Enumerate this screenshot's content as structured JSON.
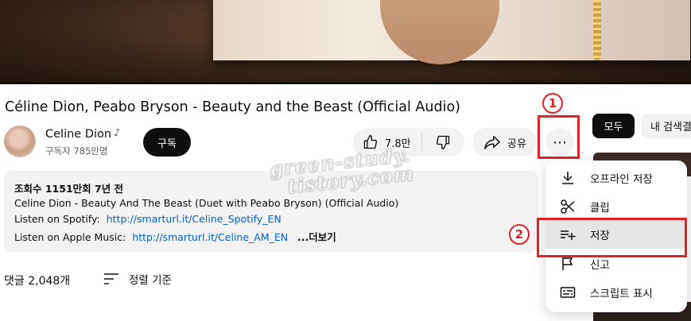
{
  "video": {
    "title": "Céline Dion, Peabo Bryson - Beauty and the Beast (Official Audio)"
  },
  "channel": {
    "name": "Celine Dion",
    "music_icon": "♪",
    "subscribers": "구독자 785만명",
    "subscribe_label": "구독"
  },
  "actions": {
    "like_count": "7.8만",
    "share_label": "공유",
    "more_label": "⋯",
    "like_icon": "thumbs-up-icon",
    "dislike_icon": "thumbs-down-icon",
    "share_icon": "share-arrow-icon"
  },
  "annotations": {
    "badge1": "1",
    "badge2": "2",
    "highlight_color": "#e0222a"
  },
  "description": {
    "stats": "조회수 1151만회  7년 전",
    "line1": "Celine Dion - Beauty And The Beast (Duet with Peabo Bryson) (Official Audio)",
    "spotify_prefix": "Listen on Spotify:",
    "spotify_link": "http://smarturl.it/Celine_Spotify_EN",
    "apple_prefix": "Listen on Apple Music:",
    "apple_link": "http://smarturl.it/Celine_AM_EN",
    "more_label": "...더보기"
  },
  "comments": {
    "count_label": "댓글 2,048개",
    "sort_label": "정렬 기준"
  },
  "chips": {
    "all": "모두",
    "search": "내 검색결"
  },
  "menu": {
    "items": [
      {
        "label": "오프라인 저장",
        "icon": "download-icon"
      },
      {
        "label": "클립",
        "icon": "scissors-icon"
      },
      {
        "label": "저장",
        "icon": "playlist-add-icon",
        "highlighted": true
      },
      {
        "label": "신고",
        "icon": "flag-icon"
      },
      {
        "label": "스크립트 표시",
        "icon": "transcript-icon"
      }
    ]
  },
  "watermark": {
    "line1": "green-study.",
    "line2": "tistory.com"
  },
  "colors": {
    "accent_link": "#065fd4",
    "chip_active": "#0f0f0f",
    "button_bg": "#f2f2f2"
  }
}
